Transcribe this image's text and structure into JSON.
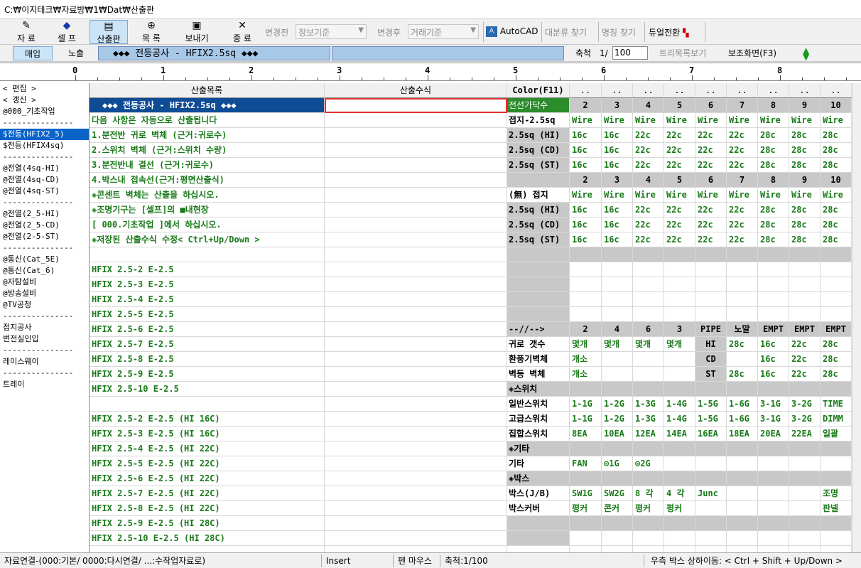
{
  "title": "C:₩이지테크₩자료방₩1₩Dat₩산출판",
  "toolbar": {
    "buttons": [
      {
        "icon": "✎",
        "label": "자 료"
      },
      {
        "icon": "◆",
        "label": "셀 프"
      },
      {
        "icon": "▤",
        "label": "산출판"
      },
      {
        "icon": "⊕",
        "label": "목 록"
      },
      {
        "icon": "▣",
        "label": "보내기"
      },
      {
        "icon": "✕",
        "label": "종 료"
      }
    ],
    "before_label": "변경전",
    "before_value": "정보기준",
    "after_label": "변경후",
    "after_value": "거래기준",
    "autocad": "AutoCAD",
    "big_search": "대분류 찾기",
    "name_search": "명칭 찾기",
    "dual": "듀얼전환"
  },
  "row2": {
    "tab1": "매입",
    "tab2": "노출",
    "banner": "◆◆◆ 전등공사 - HFIX2.5sq ◆◆◆",
    "scale_label": "축척",
    "scale_prefix": "1/",
    "scale_value": "100",
    "tree_view": "트리목록보기",
    "sub_screen": "보조화면(F3)"
  },
  "ruler": [
    "0",
    "1",
    "2",
    "3",
    "4",
    "5",
    "6",
    "7",
    "8"
  ],
  "sidebar": [
    {
      "t": "< 편집 >"
    },
    {
      "t": "< 갱신 >"
    },
    {
      "t": "@000_기초작업"
    },
    {
      "t": "---------------"
    },
    {
      "t": "$전등(HFIX2_5)",
      "sel": true
    },
    {
      "t": "$전등(HFIX4sq)"
    },
    {
      "t": "---------------"
    },
    {
      "t": "@전열(4sq-HI)"
    },
    {
      "t": "@전열(4sq-CD)"
    },
    {
      "t": "@전열(4sq-ST)"
    },
    {
      "t": "---------------"
    },
    {
      "t": "@전열(2_5-HI)"
    },
    {
      "t": "@전열(2_5-CD)"
    },
    {
      "t": "@전열(2-5-ST)"
    },
    {
      "t": "---------------"
    },
    {
      "t": "@통신(Cat_5E)"
    },
    {
      "t": "@통신(Cat_6)"
    },
    {
      "t": "@자탐설비"
    },
    {
      "t": "@방송설비"
    },
    {
      "t": "@TV공청"
    },
    {
      "t": "---------------"
    },
    {
      "t": "접지공사"
    },
    {
      "t": "변전실인입"
    },
    {
      "t": "---------------"
    },
    {
      "t": "레이스웨이"
    },
    {
      "t": "---------------"
    },
    {
      "t": "트레이"
    }
  ],
  "grid": {
    "headers": [
      "산출목록",
      "산출수식",
      "Color(F11)",
      "..",
      "..",
      "..",
      "..",
      "..",
      "..",
      "..",
      "..",
      ".."
    ],
    "rows": [
      {
        "a": "◆◆◆ 전등공사 - HFIX2.5sq ◆◆◆",
        "c": "전선가닥수",
        "cells": [
          "2",
          "3",
          "4",
          "5",
          "6",
          "7",
          "8",
          "9",
          "10"
        ],
        "sel": true,
        "cellsGray": true
      },
      {
        "a": "다음 사항은 자동으로 산출됩니다",
        "c": "접지-2.5sq",
        "cells": [
          "Wire",
          "Wire",
          "Wire",
          "Wire",
          "Wire",
          "Wire",
          "Wire",
          "Wire",
          "Wire"
        ]
      },
      {
        "a": " 1.분전반 귀로 벽체 (근거:귀로수)",
        "c": "2.5sq (HI)",
        "cGray": true,
        "cells": [
          "16c",
          "16c",
          "22c",
          "22c",
          "22c",
          "22c",
          "28c",
          "28c",
          "28c"
        ]
      },
      {
        "a": " 2.스위치 벽체 (근거:스위치 수량)",
        "c": "2.5sq (CD)",
        "cGray": true,
        "cells": [
          "16c",
          "16c",
          "22c",
          "22c",
          "22c",
          "22c",
          "28c",
          "28c",
          "28c"
        ]
      },
      {
        "a": " 3.분전반내 결선    (근거:귀로수)",
        "c": "2.5sq (ST)",
        "cGray": true,
        "cells": [
          "16c",
          "16c",
          "22c",
          "22c",
          "22c",
          "22c",
          "28c",
          "28c",
          "28c"
        ]
      },
      {
        "a": " 4.박스내 접속선(근거:평면산출식)",
        "c": "",
        "cGray": true,
        "cells": [
          "2",
          "3",
          "4",
          "5",
          "6",
          "7",
          "8",
          "9",
          "10"
        ],
        "cellsGray": true
      },
      {
        "a": "◈콘센트 벽체는 산출을 하십시오.",
        "c": "(無) 접지",
        "cells": [
          "Wire",
          "Wire",
          "Wire",
          "Wire",
          "Wire",
          "Wire",
          "Wire",
          "Wire",
          "Wire"
        ]
      },
      {
        "a": "◈조명기구는 [셀프]의  ■내현장",
        "c": "2.5sq (HI)",
        "cGray": true,
        "cells": [
          "16c",
          "16c",
          "22c",
          "22c",
          "22c",
          "22c",
          "28c",
          "28c",
          "28c"
        ]
      },
      {
        "a": "  [ 000.기초작업 ]에서 하십시오.",
        "c": "2.5sq (CD)",
        "cGray": true,
        "cells": [
          "16c",
          "16c",
          "22c",
          "22c",
          "22c",
          "22c",
          "28c",
          "28c",
          "28c"
        ]
      },
      {
        "a": "◈저장된 산출수식 수정< Ctrl+Up/Down >",
        "c": "2.5sq (ST)",
        "cGray": true,
        "cells": [
          "16c",
          "16c",
          "22c",
          "22c",
          "22c",
          "22c",
          "28c",
          "28c",
          "28c"
        ]
      },
      {
        "a": "",
        "c": "",
        "cGray": true,
        "cells": [
          "",
          "",
          "",
          "",
          "",
          "",
          "",
          "",
          ""
        ],
        "cellsGray": true
      },
      {
        "a": "HFIX 2.5-2 E-2.5",
        "c": "",
        "cGray": true,
        "cells": [
          "",
          "",
          "",
          "",
          "",
          "",
          "",
          "",
          ""
        ]
      },
      {
        "a": "HFIX 2.5-3 E-2.5",
        "c": "",
        "cGray": true,
        "cells": [
          "",
          "",
          "",
          "",
          "",
          "",
          "",
          "",
          ""
        ]
      },
      {
        "a": "HFIX 2.5-4 E-2.5",
        "c": "",
        "cGray": true,
        "cells": [
          "",
          "",
          "",
          "",
          "",
          "",
          "",
          "",
          ""
        ]
      },
      {
        "a": "HFIX 2.5-5 E-2.5",
        "c": "",
        "cGray": true,
        "cells": [
          "",
          "",
          "",
          "",
          "",
          "",
          "",
          "",
          ""
        ]
      },
      {
        "a": "HFIX 2.5-6 E-2.5",
        "c": "--//-->",
        "cGray": true,
        "cells": [
          "2",
          "4",
          "6",
          "3",
          "PIPE",
          "노말",
          "EMPT",
          "EMPT",
          "EMPT"
        ],
        "cellsGray": true
      },
      {
        "a": "HFIX 2.5-7 E-2.5",
        "c": "귀로 갯수",
        "cells": [
          "몇개",
          "몇개",
          "몇개",
          "몇개",
          "HI",
          "28c",
          "16c",
          "22c",
          "28c"
        ],
        "grayIdx": [
          4
        ]
      },
      {
        "a": "HFIX 2.5-8 E-2.5",
        "c": "환풍기벽체",
        "cells": [
          "개소",
          "",
          "",
          "",
          "CD",
          "",
          "16c",
          "22c",
          "28c"
        ],
        "grayIdx": [
          4
        ]
      },
      {
        "a": "HFIX 2.5-9 E-2.5",
        "c": "벽등  벽체",
        "cells": [
          "개소",
          "",
          "",
          "",
          "ST",
          "28c",
          "16c",
          "22c",
          "28c"
        ],
        "grayIdx": [
          4
        ]
      },
      {
        "a": "HFIX 2.5-10 E-2.5",
        "c": "◈스위치",
        "cGray": true,
        "cells": [
          "",
          "",
          "",
          "",
          "",
          "",
          "",
          "",
          ""
        ],
        "cellsGray": true
      },
      {
        "a": "",
        "c": "일반스위치",
        "cells": [
          "1-1G",
          "1-2G",
          "1-3G",
          "1-4G",
          "1-5G",
          "1-6G",
          "3-1G",
          "3-2G",
          "TIME"
        ]
      },
      {
        "a": "HFIX 2.5-2 E-2.5 (HI 16C)",
        "c": "고급스위치",
        "cells": [
          "1-1G",
          "1-2G",
          "1-3G",
          "1-4G",
          "1-5G",
          "1-6G",
          "3-1G",
          "3-2G",
          "DIMM"
        ]
      },
      {
        "a": "HFIX 2.5-3 E-2.5 (HI 16C)",
        "c": "집합스위치",
        "cells": [
          "8EA",
          "10EA",
          "12EA",
          "14EA",
          "16EA",
          "18EA",
          "20EA",
          "22EA",
          "일괄"
        ]
      },
      {
        "a": "HFIX 2.5-4 E-2.5 (HI 22C)",
        "c": "◈기타",
        "cGray": true,
        "cells": [
          "",
          "",
          "",
          "",
          "",
          "",
          "",
          "",
          ""
        ],
        "cellsGray": true
      },
      {
        "a": "HFIX 2.5-5 E-2.5 (HI 22C)",
        "c": "기타",
        "cells": [
          "FAN",
          "⊙1G",
          "⊙2G",
          "",
          "",
          "",
          "",
          "",
          ""
        ]
      },
      {
        "a": "HFIX 2.5-6 E-2.5 (HI 22C)",
        "c": "◈박스",
        "cGray": true,
        "cells": [
          "",
          "",
          "",
          "",
          "",
          "",
          "",
          "",
          ""
        ],
        "cellsGray": true
      },
      {
        "a": "HFIX 2.5-7 E-2.5 (HI 22C)",
        "c": "박스(J/B)",
        "cells": [
          "SW1G",
          "SW2G",
          "8 각",
          "4 각",
          "Junc",
          "",
          "",
          "",
          "조명"
        ]
      },
      {
        "a": "HFIX 2.5-8 E-2.5 (HI 22C)",
        "c": "박스커버",
        "cells": [
          "평커",
          "콘커",
          "평커",
          "평커",
          "",
          "",
          "",
          "",
          "판넬"
        ]
      },
      {
        "a": "HFIX 2.5-9 E-2.5 (HI 28C)",
        "c": "",
        "cGray": true,
        "cells": [
          "",
          "",
          "",
          "",
          "",
          "",
          "",
          "",
          ""
        ],
        "cellsGray": true
      },
      {
        "a": "HFIX 2.5-10 E-2.5 (HI 28C)",
        "c": "",
        "cGray": true,
        "cells": [
          "",
          "",
          "",
          "",
          "",
          "",
          "",
          "",
          ""
        ]
      },
      {
        "a": "",
        "c": "",
        "cells": [
          "",
          "",
          "",
          "",
          "",
          "",
          "",
          "",
          ""
        ]
      }
    ]
  },
  "status": {
    "left": "자료연결-(000:기본/ 0000:다시연결/ ...:수작업자료로)",
    "mode": "Insert",
    "mouse": "펜 마우스",
    "scale": "축척:1/100",
    "hint": "우측 박스 상하이동: < Ctrl + Shift + Up/Down >"
  }
}
